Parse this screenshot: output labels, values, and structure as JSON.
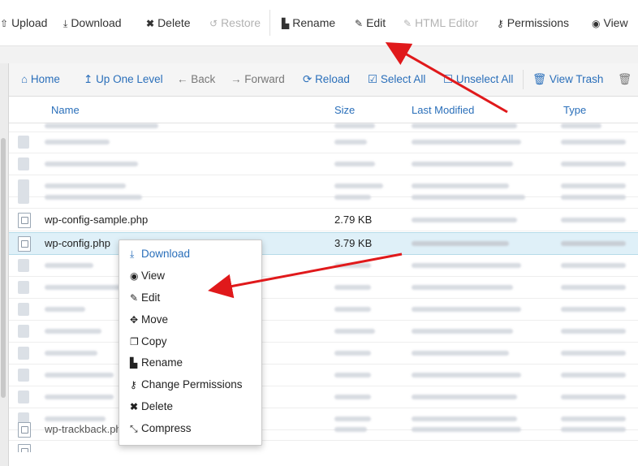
{
  "toolbar": {
    "upload": "Upload",
    "download": "Download",
    "delete": "Delete",
    "restore": "Restore",
    "rename": "Rename",
    "edit": "Edit",
    "html_editor": "HTML Editor",
    "permissions": "Permissions",
    "view": "View"
  },
  "nav": {
    "home": "Home",
    "up_one_level": "Up One Level",
    "back": "Back",
    "forward": "Forward",
    "reload": "Reload",
    "select_all": "Select All",
    "unselect_all": "Unselect All",
    "view_trash": "View Trash"
  },
  "table": {
    "headers": {
      "name": "Name",
      "size": "Size",
      "last_modified": "Last Modified",
      "type": "Type"
    },
    "rows": [
      {
        "name": "wp-config-sample.php",
        "size": "2.79 KB"
      },
      {
        "name": "wp-config.php",
        "size": "3.79 KB"
      }
    ],
    "partial_row_name": "wp-trackback.ph"
  },
  "context_menu": {
    "download": "Download",
    "view": "View",
    "edit": "Edit",
    "move": "Move",
    "copy": "Copy",
    "rename": "Rename",
    "change_permissions": "Change Permissions",
    "delete": "Delete",
    "compress": "Compress"
  },
  "colors": {
    "link_blue": "#2a6fba",
    "selected_row": "#dff0f8",
    "arrow_red": "#e0191b"
  },
  "icons": [
    "upload-icon",
    "download-icon",
    "delete-icon",
    "restore-icon",
    "rename-icon",
    "edit-icon",
    "html-editor-icon",
    "permissions-icon",
    "view-icon",
    "home-icon",
    "up-level-icon",
    "back-icon",
    "forward-icon",
    "reload-icon",
    "select-all-icon",
    "unselect-all-icon",
    "trash-icon",
    "file-code-icon",
    "move-icon",
    "copy-icon",
    "compress-icon"
  ]
}
